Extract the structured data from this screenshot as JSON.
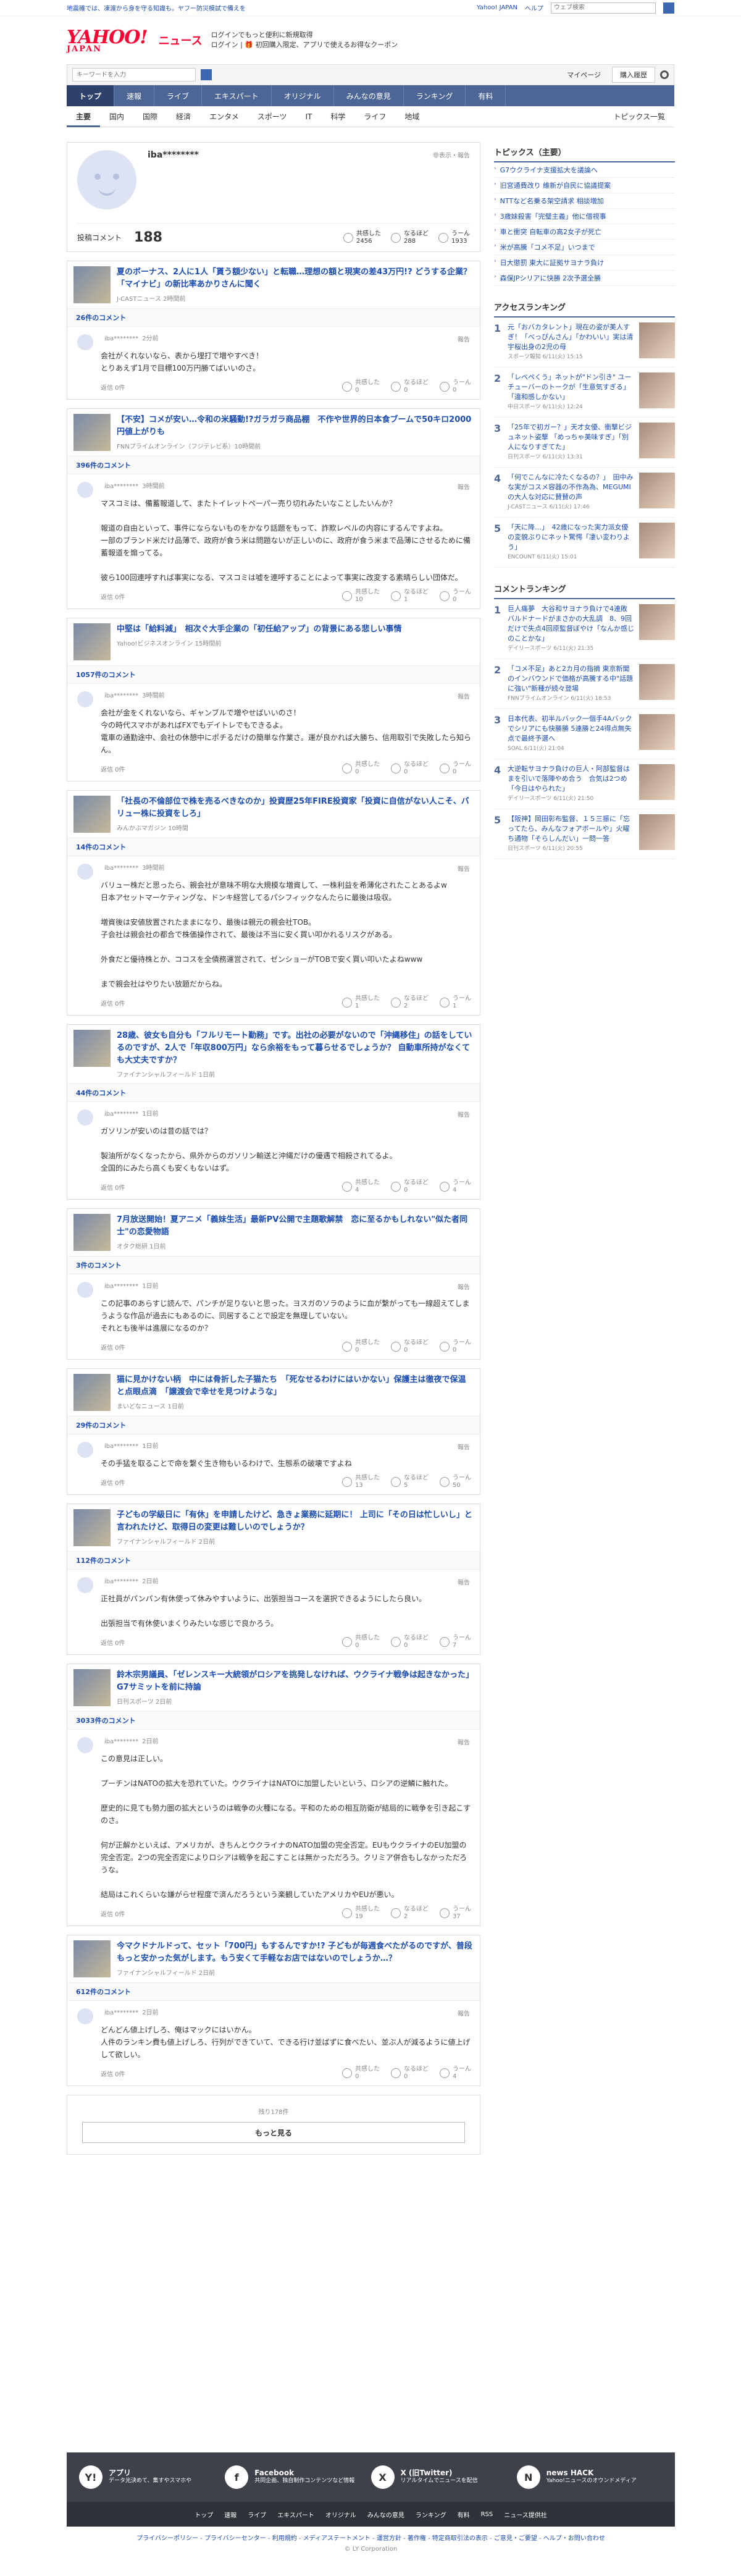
{
  "notice": {
    "text": "地震確では、凍渡から身を守る知識も。ヤフー防災模試で備えを",
    "yjapan": "Yahoo! JAPAN",
    "help": "ヘルプ",
    "search_placeholder": "ウェブ検索"
  },
  "header": {
    "logo": "YAHOO!",
    "logo_sub": "JAPAN",
    "logo_news": "ニュース",
    "promo1": "ログインでもっと便利に新規取得",
    "promo2": "ログイン | 🎁 初回購入限定、アプリで使えるお得なクーポン"
  },
  "searchbar": {
    "placeholder": "キーワードを入力",
    "mypage": "マイページ",
    "purchase": "購入履歴"
  },
  "nav1": [
    "トップ",
    "速報",
    "ライブ",
    "エキスパート",
    "オリジナル",
    "みんなの意見",
    "ランキング",
    "有料"
  ],
  "nav2": [
    "主要",
    "国内",
    "国際",
    "経済",
    "エンタメ",
    "スポーツ",
    "IT",
    "科学",
    "ライフ",
    "地域"
  ],
  "nav2_right": "トピックス一覧",
  "profile": {
    "name": "iba********",
    "note": "非表示・報告",
    "label": "投稿コメント",
    "count": "188",
    "stats": [
      {
        "label": "共感した",
        "value": "2456"
      },
      {
        "label": "なるほど",
        "value": "288"
      },
      {
        "label": "うーん",
        "value": "1933"
      }
    ]
  },
  "reply": "返信 0件",
  "report": "報告",
  "articles": [
    {
      "title": "夏のボーナス、2人に1人「貰う額少ない」と転職…理想の額と現実の差43万円!? どうする企業？「マイナビ」の新比率あかりさんに聞く",
      "source": "J-CASTニュース 2時間前",
      "count": "26件のコメント",
      "user": "iba********",
      "time": "2分前",
      "body": "会社がくれないなら、表から埋打で増やすべき！\nとりあえず1月で目標100万円勝てばいいのさ。",
      "r": [
        "0",
        "0",
        "0"
      ]
    },
    {
      "title": "【不安】コメが安い…令和の米騒動!?ガラガラ商品棚　不作や世界的日本食ブームで50キロ2000円値上がりも",
      "source": "FNNプライムオンライン（フジテレビ系）10時間前",
      "count": "396件のコメント",
      "user": "iba********",
      "time": "3時間前",
      "body": "マスコミは、備蓄報道して、またトイレットペーパー売り切れみたいなことしたいんか？\n\n報道の自由といって、事件にならないものをかなり話題をもって、詐欺レベルの内容にするんですよね。\n一部のブランド米だけ品薄で、政府が食う米は問題ないが正しいのに、政府が食う米まで品薄にさせるために備蓄報道を煽ってる。\n\n彼ら100回連呼すれば事実になる、マスコミは嘘を連呼することによって事実に改変する素晴らしい団体だ。",
      "r": [
        "10",
        "1",
        "0"
      ]
    },
    {
      "title": "中堅は「給料減」　相次ぐ大手企業の「初任給アップ」の背景にある悲しい事情",
      "source": "Yahoo!ビジネスオンライン 15時間前",
      "count": "1057件のコメント",
      "user": "iba********",
      "time": "3時間前",
      "body": "会社が金をくれないなら、ギャンブルで増やせばいいのさ！\n今の時代スマホがあればFXでもデイトレでもできるよ。\n電車の通勤途中、会社の休憩中にポチるだけの簡単な作業さ。運が良かれば大勝ち、信用取引で失敗したら知らん。",
      "r": [
        "0",
        "0",
        "0"
      ]
    },
    {
      "title": "「社長の不倫部位で株を売るべきなのか」投資歴25年FIRE投資家「投資に自信がない人こそ、バリュー株に投資をしろ」",
      "source": "みんかぶマガジン 10時間",
      "count": "14件のコメント",
      "user": "iba********",
      "time": "3時間前",
      "body": "バリュー株だと思ったら、親会社が意味不明な大規模な増資して、一株利益を希薄化されたことあるよw\n日本アセットマーケティングな、ドンキ経営してるパシフィックなんたらに最後は吸収。\n\n増資後は安値放置されたままになり、最後は親元の親会社TOB。\n子会社は親会社の都合で株価操作されて、最後は不当に安く買い叩かれるリスクがある。\n\n外食だと優待株とか、ココスを全債務運営されて、ゼンショーがTOBで安く買い叩いたよねwww\n\nまで親会社はやりたい放題だからね。",
      "r": [
        "1",
        "2",
        "1"
      ]
    },
    {
      "title": "28歳、彼女も自分も「フルリモート勤務」です。出社の必要がないので「沖縄移住」の話をしているのですが、2人で「年収800万円」なら余裕をもって暮らせるでしょうか？ 自動車所持がなくても大丈夫ですか？",
      "source": "ファイナンシャルフィールド 1日前",
      "count": "44件のコメント",
      "user": "iba********",
      "time": "1日前",
      "body": "ガソリンが安いのは昔の話では？\n\n製油所がなくなったから、県外からのガソリン輸送と沖縄だけの優遇で相殺されてるよ。\n全国的にみたら高くも安くもないはず。",
      "r": [
        "4",
        "0",
        "4"
      ]
    },
    {
      "title": "7月放送開始！夏アニメ「義妹生活」最新PV公開で主題歌解禁　恋に至るかもしれない\"似た者同士\"の恋愛物語",
      "source": "オタク総研 1日前",
      "count": "3件のコメント",
      "user": "iba********",
      "time": "1日前",
      "body": "この記事のあらすじ読んで、パンチが足りないと思った。ヨスガのソラのように血が繋がっても一線超えてしまうような作品が過去にもあるのに、同居することで設定を無理していない。\nそれとも後半は進展になるのか？",
      "r": [
        "0",
        "0",
        "0"
      ]
    },
    {
      "title": "猫に見かけない柄　中には骨折した子猫たち　「死なせるわけにはいかない」保護主は徹夜で保温と点眼点滴　「譲渡会で幸せを見つけような」",
      "source": "まいどなニュース 1日前",
      "count": "29件のコメント",
      "user": "iba********",
      "time": "1日前",
      "body": "その手猛を取ることで命を繋ぐ生き物もいるわけで、生態系の破壊ですよね",
      "r": [
        "13",
        "5",
        "50"
      ]
    },
    {
      "title": "子どもの学級日に「有休」を申請したけど、急きょ業務に延期に！ 上司に「その日は忙しいし」と言われたけど、取得日の変更は難しいのでしょうか？",
      "source": "ファイナンシャルフィールド 2日前",
      "count": "112件のコメント",
      "user": "iba********",
      "time": "2日前",
      "body": "正社員がパンパン有休使って休みやすいように、出張担当コースを選択できるようにしたら良い。\n\n出張担当で有休使いまくりみたいな感じで良かろう。",
      "r": [
        "0",
        "0",
        "7"
      ]
    },
    {
      "title": "鈴木宗男議員、「ゼレンスキー大統領がロシアを挑発しなければ、ウクライナ戦争は起きなかった」 G7サミットを前に持論",
      "source": "日刊スポーツ 2日前",
      "count": "3033件のコメント",
      "user": "iba********",
      "time": "2日前",
      "body": "この意見は正しい。\n\nプーチンはNATOの拡大を恐れていた。ウクライナはNATOに加盟したいという、ロシアの逆鱗に触れた。\n\n歴史的に見ても勢力圏の拡大というのは戦争の火種になる。平和のための相互防衛が結局的に戦争を引き起こすのさ。\n\n何が正解かといえば、アメリカが、きちんとウクライナのNATO加盟の完全否定。EUもウクライナのEU加盟の完全否定。2つの完全否定によりロシアは戦争を起こすことは無かっただろう。クリミア併合もしなかっただろうな。\n\n結局はこれくらいな嫌がらせ程度で済んだろうという楽観していたアメリカやEUが悪い。",
      "r": [
        "19",
        "2",
        "37"
      ]
    },
    {
      "title": "今マクドナルドって、セット「700円」もするんですか!? 子どもが毎週食べたがるのですが、普段もっと安かった気がします。もう安くて手軽なお店ではないのでしょうか…？",
      "source": "ファイナンシャルフィールド 2日前",
      "count": "612件のコメント",
      "user": "iba********",
      "time": "2日前",
      "body": "どんどん値上げしろ、俺はマックにはいかん。\n人件のランキン費も値上げしろ、行列ができていて、できる行け並ばずに食べたい、並ぶ人が減るように値上げして欲しい。",
      "r": [
        "0",
        "0",
        "4"
      ]
    }
  ],
  "more": {
    "left": "残り178件",
    "button": "もっと見る"
  },
  "sidebar": {
    "topics_title": "トピックス（主要）",
    "topics": [
      "G7ウクライナ支援拡大を議論へ",
      "旧宮通費改り 維新が自民に協議提案",
      "NTTなど名乗る架空請求 相談増加",
      "3歳妹殺害「完璧主義」他に借視事",
      "車と衝突 自転車の高2女子が死亡",
      "米が高騰「コメ不足」いつまで",
      "日大懲罰 東大に証拠サヨナラ負け",
      "森保JPシリアに快勝 2次予選全勝"
    ],
    "access_title": "アクセスランキング",
    "access": [
      {
        "t": "元「おバカタレント」現在の姿が美人すぎ！「べっぴんさん」「かわいい」実は清宇桜出身の2児の母",
        "m": "スポーツ報知 6/11(火) 15:15"
      },
      {
        "t": "「レベペくう」ネットが\"ドン引き\" ユーチューバーのトークが「生意気すぎる」「違和感しかない」",
        "m": "中日スポーツ 6/11(火) 12:24"
      },
      {
        "t": "「25年で初ガー？」天才女優、衝撃ビジュネット姿撃 「めっちゃ美味すぎ」「別人になりすぎてた」",
        "m": "日刊スポーツ 6/11(火) 13:31"
      },
      {
        "t": "「何でこんなに冷たくなるの？」　田中みな実がコスメ容器の不作為為、MEGUMIの大人な対応に賛賛の声",
        "m": "J-CASTニュース 6/11(火) 17:46"
      },
      {
        "t": "「天に降…」　42歳になった実力派女優の変貌ぶりにネット驚愕「凄い変わりよう」",
        "m": "ENCOUNT 6/11(火) 15:01"
      }
    ],
    "comment_title": "コメントランキング",
    "comment": [
      {
        "t": "巨人痛夢　大谷和サヨナラ負けで4連敗　バルドナードがまさかの大乱調　8、9回だけで失点4回原監督ぼやけ「なんか感じのことかな」",
        "m": "デイリースポーツ 6/11(火) 21:35"
      },
      {
        "t": "「コメ不足」あと2カ月の指摘 東京新聞のインバウンドで価格が高騰する中\"話題に強い\"新種が続々登場",
        "m": "FNNプライムオンライン 6/11(火) 18:53"
      },
      {
        "t": "日本代表、初半ルバック一個手4Aバックでシリアにも快勝勝 5連勝と24得点無失点で最終予選へ",
        "m": "SOAL 6/11(火) 21:04"
      },
      {
        "t": "大逆転サヨナラ負けの巨人・阿部監督はまを引いで落陣やめ合う　合気は2つめ「今日はやられた」",
        "m": "デイリースポーツ 6/11(火) 21:50"
      },
      {
        "t": "【阪神】岡田彰布監督、１５三振に「忘ってたら、みんなフォアボールや」火曜ち通物「そらしんだい」一問一答",
        "m": "日刊スポーツ 6/11(火) 20:55"
      }
    ]
  },
  "footer": {
    "apps": [
      {
        "icon": "Y!",
        "name": "アプリ",
        "desc": "データ光決めて、集すやスマホや"
      },
      {
        "icon": "f",
        "name": "Facebook",
        "desc": "共同企画、独自制作コンテンツなど情報"
      },
      {
        "icon": "X",
        "name": "X (旧Twitter)",
        "desc": "リアルタイムでニュースを配信"
      },
      {
        "icon": "N",
        "name": "news HACK",
        "desc": "Yahoo!ニュースのオウンドメディア"
      }
    ],
    "links": [
      "トップ",
      "速報",
      "ライブ",
      "エキスパート",
      "オリジナル",
      "みんなの意見",
      "ランキング",
      "有料",
      "RSS",
      "ニュース提供社"
    ],
    "legal": "プライバシーポリシー - プライバシーセンター - 利用規約 - メディアステートメント - 運営方針 - 著作権 - 特定商取引法の表示 - ご意見・ご要望 - ヘルプ・お問い合わせ",
    "copyright": "© LY Corporation"
  }
}
